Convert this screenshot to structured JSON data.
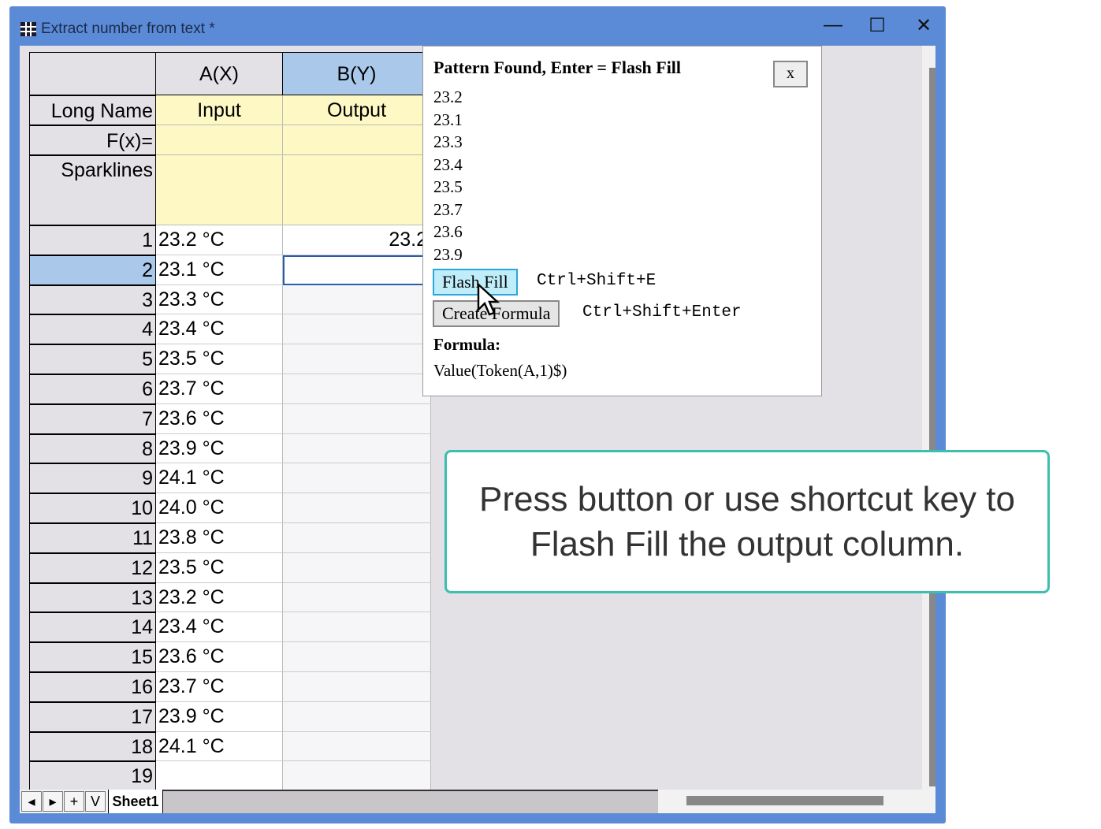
{
  "window": {
    "title": "Extract number from text *",
    "minimize": "—",
    "maximize": "☐",
    "close": "✕"
  },
  "grid": {
    "corner": "",
    "columns": [
      "A(X)",
      "B(Y)"
    ],
    "long_name_label": "Long Name",
    "long_names": [
      "Input",
      "Output"
    ],
    "fx_label": "F(x)=",
    "sparklines_label": "Sparklines",
    "rows": [
      {
        "n": "1",
        "a": "23.2 °C",
        "b": "23.2"
      },
      {
        "n": "2",
        "a": "23.1 °C",
        "b": ""
      },
      {
        "n": "3",
        "a": "23.3 °C",
        "b": ""
      },
      {
        "n": "4",
        "a": "23.4 °C",
        "b": ""
      },
      {
        "n": "5",
        "a": "23.5 °C",
        "b": ""
      },
      {
        "n": "6",
        "a": "23.7 °C",
        "b": ""
      },
      {
        "n": "7",
        "a": "23.6 °C",
        "b": ""
      },
      {
        "n": "8",
        "a": "23.9 °C",
        "b": ""
      },
      {
        "n": "9",
        "a": "24.1 °C",
        "b": ""
      },
      {
        "n": "10",
        "a": "24.0 °C",
        "b": ""
      },
      {
        "n": "11",
        "a": "23.8 °C",
        "b": ""
      },
      {
        "n": "12",
        "a": "23.5 °C",
        "b": ""
      },
      {
        "n": "13",
        "a": "23.2 °C",
        "b": ""
      },
      {
        "n": "14",
        "a": "23.4 °C",
        "b": ""
      },
      {
        "n": "15",
        "a": "23.6 °C",
        "b": ""
      },
      {
        "n": "16",
        "a": "23.7 °C",
        "b": ""
      },
      {
        "n": "17",
        "a": "23.9 °C",
        "b": ""
      },
      {
        "n": "18",
        "a": "24.1 °C",
        "b": ""
      },
      {
        "n": "19",
        "a": "",
        "b": ""
      }
    ]
  },
  "popup": {
    "title": "Pattern Found, Enter = Flash Fill",
    "close": "x",
    "values": [
      "23.2",
      "23.1",
      "23.3",
      "23.4",
      "23.5",
      "23.7",
      "23.6",
      "23.9"
    ],
    "flash_fill": "Flash Fill",
    "flash_fill_shortcut": "Ctrl+Shift+E",
    "create_formula": "Create Formula",
    "create_formula_shortcut": "Ctrl+Shift+Enter",
    "formula_label": "Formula:",
    "formula": "Value(Token(A,1)$)"
  },
  "callout": "Press button or use shortcut key to Flash Fill the output column.",
  "sheets": {
    "nav": [
      "◂",
      "▸",
      "+",
      "V"
    ],
    "tabs": [
      "Sheet1"
    ]
  }
}
